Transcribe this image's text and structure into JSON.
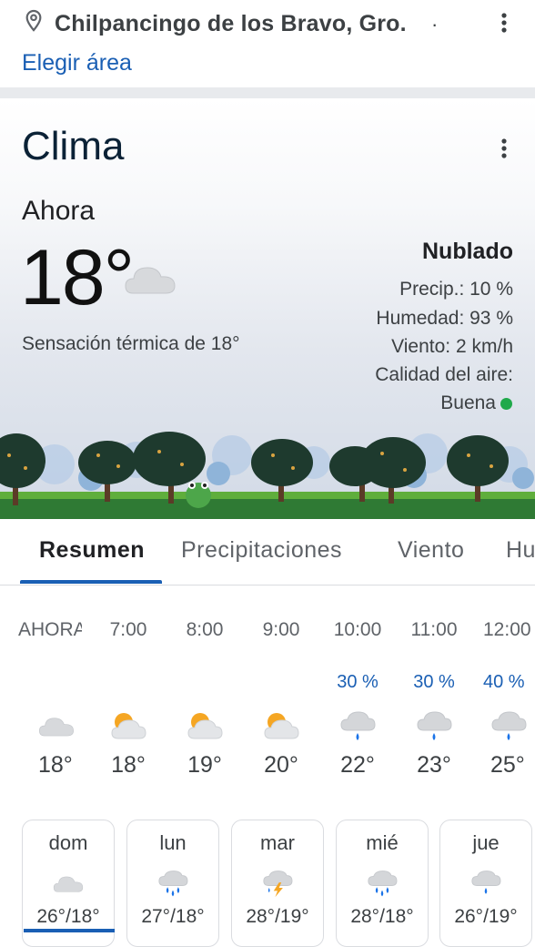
{
  "location": {
    "title": "Chilpancingo de los Bravo, Gro.",
    "trailing_dot": "·",
    "change_area": "Elegir área"
  },
  "weather": {
    "title": "Clima",
    "now_label": "Ahora",
    "temp": "18°",
    "feels_like": "Sensación térmica de 18°",
    "condition": "Nublado",
    "precip": "Precip.: 10 %",
    "humidity": "Humedad: 93 %",
    "wind": "Viento: 2 km/h",
    "air_quality_label": "Calidad del aire:",
    "air_quality_value": "Buena",
    "air_quality_color": "#1fa94a",
    "now_icon": "cloudy-icon"
  },
  "tabs": [
    {
      "label": "Resumen",
      "active": true
    },
    {
      "label": "Precipitaciones",
      "active": false
    },
    {
      "label": "Viento",
      "active": false
    },
    {
      "label": "Humedad",
      "active": false
    }
  ],
  "hourly": [
    {
      "time": "AHORA",
      "precip": "",
      "icon": "cloudy-icon",
      "temp": "18°"
    },
    {
      "time": "7:00",
      "precip": "",
      "icon": "partly-cloudy-icon",
      "temp": "18°"
    },
    {
      "time": "8:00",
      "precip": "",
      "icon": "partly-cloudy-icon",
      "temp": "19°"
    },
    {
      "time": "9:00",
      "precip": "",
      "icon": "partly-cloudy-icon",
      "temp": "20°"
    },
    {
      "time": "10:00",
      "precip": "30 %",
      "icon": "rain-icon",
      "temp": "22°"
    },
    {
      "time": "11:00",
      "precip": "30 %",
      "icon": "rain-icon",
      "temp": "23°"
    },
    {
      "time": "12:00",
      "precip": "40 %",
      "icon": "rain-icon",
      "temp": "25°"
    }
  ],
  "daily": [
    {
      "day": "dom",
      "icon": "cloudy-icon",
      "range": "26°/18°"
    },
    {
      "day": "lun",
      "icon": "showers-icon",
      "range": "27°/18°"
    },
    {
      "day": "mar",
      "icon": "thunderstorm-icon",
      "range": "28°/19°"
    },
    {
      "day": "mié",
      "icon": "showers-icon",
      "range": "28°/18°"
    },
    {
      "day": "jue",
      "icon": "rain-icon",
      "range": "26°/19°"
    }
  ],
  "colors": {
    "accent": "#1a5fb4",
    "sun": "#f5a623",
    "rain": "#1a73e8"
  }
}
